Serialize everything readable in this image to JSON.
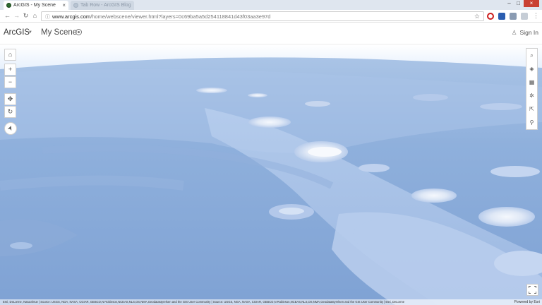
{
  "browser": {
    "active_tab": {
      "title": "ArcGIS - My Scene",
      "close": "×"
    },
    "inactive_tab": {
      "title": "Tab Row - ArcGIS Blog"
    },
    "window_controls": {
      "minimize": "–",
      "maximize": "□",
      "close": "×"
    },
    "nav": {
      "back": "←",
      "forward": "→",
      "reload": "↻",
      "home": "⌂"
    },
    "url_lock": "ⓘ",
    "url_host": "www.arcgis.com",
    "url_path": "/home/webscene/viewer.html?layers=0c69ba5a5d254118841d43f03aa3e97d",
    "bookmark_star": "☆",
    "menu": "⋮"
  },
  "header": {
    "brand": "ArcGIS",
    "brand_caret": "▼",
    "scene_title": "My Scene",
    "sign_in": "Sign In",
    "sign_in_icon": "♙"
  },
  "left_tools": {
    "home": "⌂",
    "zoom_in": "+",
    "zoom_out": "−",
    "pan": "✥",
    "rotate": "↻",
    "compass": "➤"
  },
  "right_tools": {
    "search": "⌕",
    "layers": "◈",
    "basemap": "▦",
    "settings": "✲",
    "share": "⇱",
    "slides": "⚲"
  },
  "attribution": "Esri, DeLorme, NaturalVue | Source: USGS, NGA, NASA, CGIAR, GEBCO,N Robinson,NCEAS,NLS,OS,NMA,Geodatastyrelsen and the GIS User Community | Source: USGS, NGA, NASA, CGIAR, GEBCO,N Robinson,NCEAS,NLS,OS,NMA,Geodatastyrelsen and the GIS User Community | Esri, DeLorme",
  "powered_by": "Powered by Esri",
  "colors": {
    "ocean_deep": "#7e9fd0",
    "ocean_shallow": "#a6c2e6",
    "sky": "#ffffff",
    "accent_close": "#c94032"
  }
}
